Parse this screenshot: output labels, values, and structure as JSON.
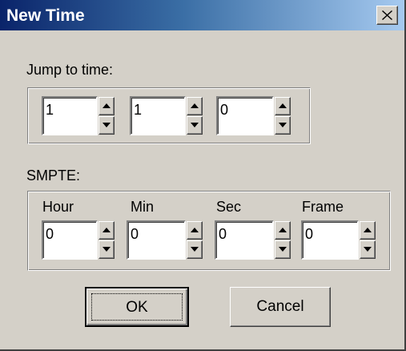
{
  "window": {
    "title": "New Time",
    "close_glyph": "✕"
  },
  "jump": {
    "label": "Jump to time:",
    "fields": [
      "1",
      "1",
      "0"
    ]
  },
  "smpte": {
    "label": "SMPTE:",
    "columns": [
      {
        "header": "Hour",
        "value": "0"
      },
      {
        "header": "Min",
        "value": "0"
      },
      {
        "header": "Sec",
        "value": "0"
      },
      {
        "header": "Frame",
        "value": "0"
      }
    ]
  },
  "buttons": {
    "ok": "OK",
    "cancel": "Cancel"
  },
  "colors": {
    "title_start": "#0a246a",
    "title_end": "#a6caf0",
    "face": "#d4d0c8"
  }
}
